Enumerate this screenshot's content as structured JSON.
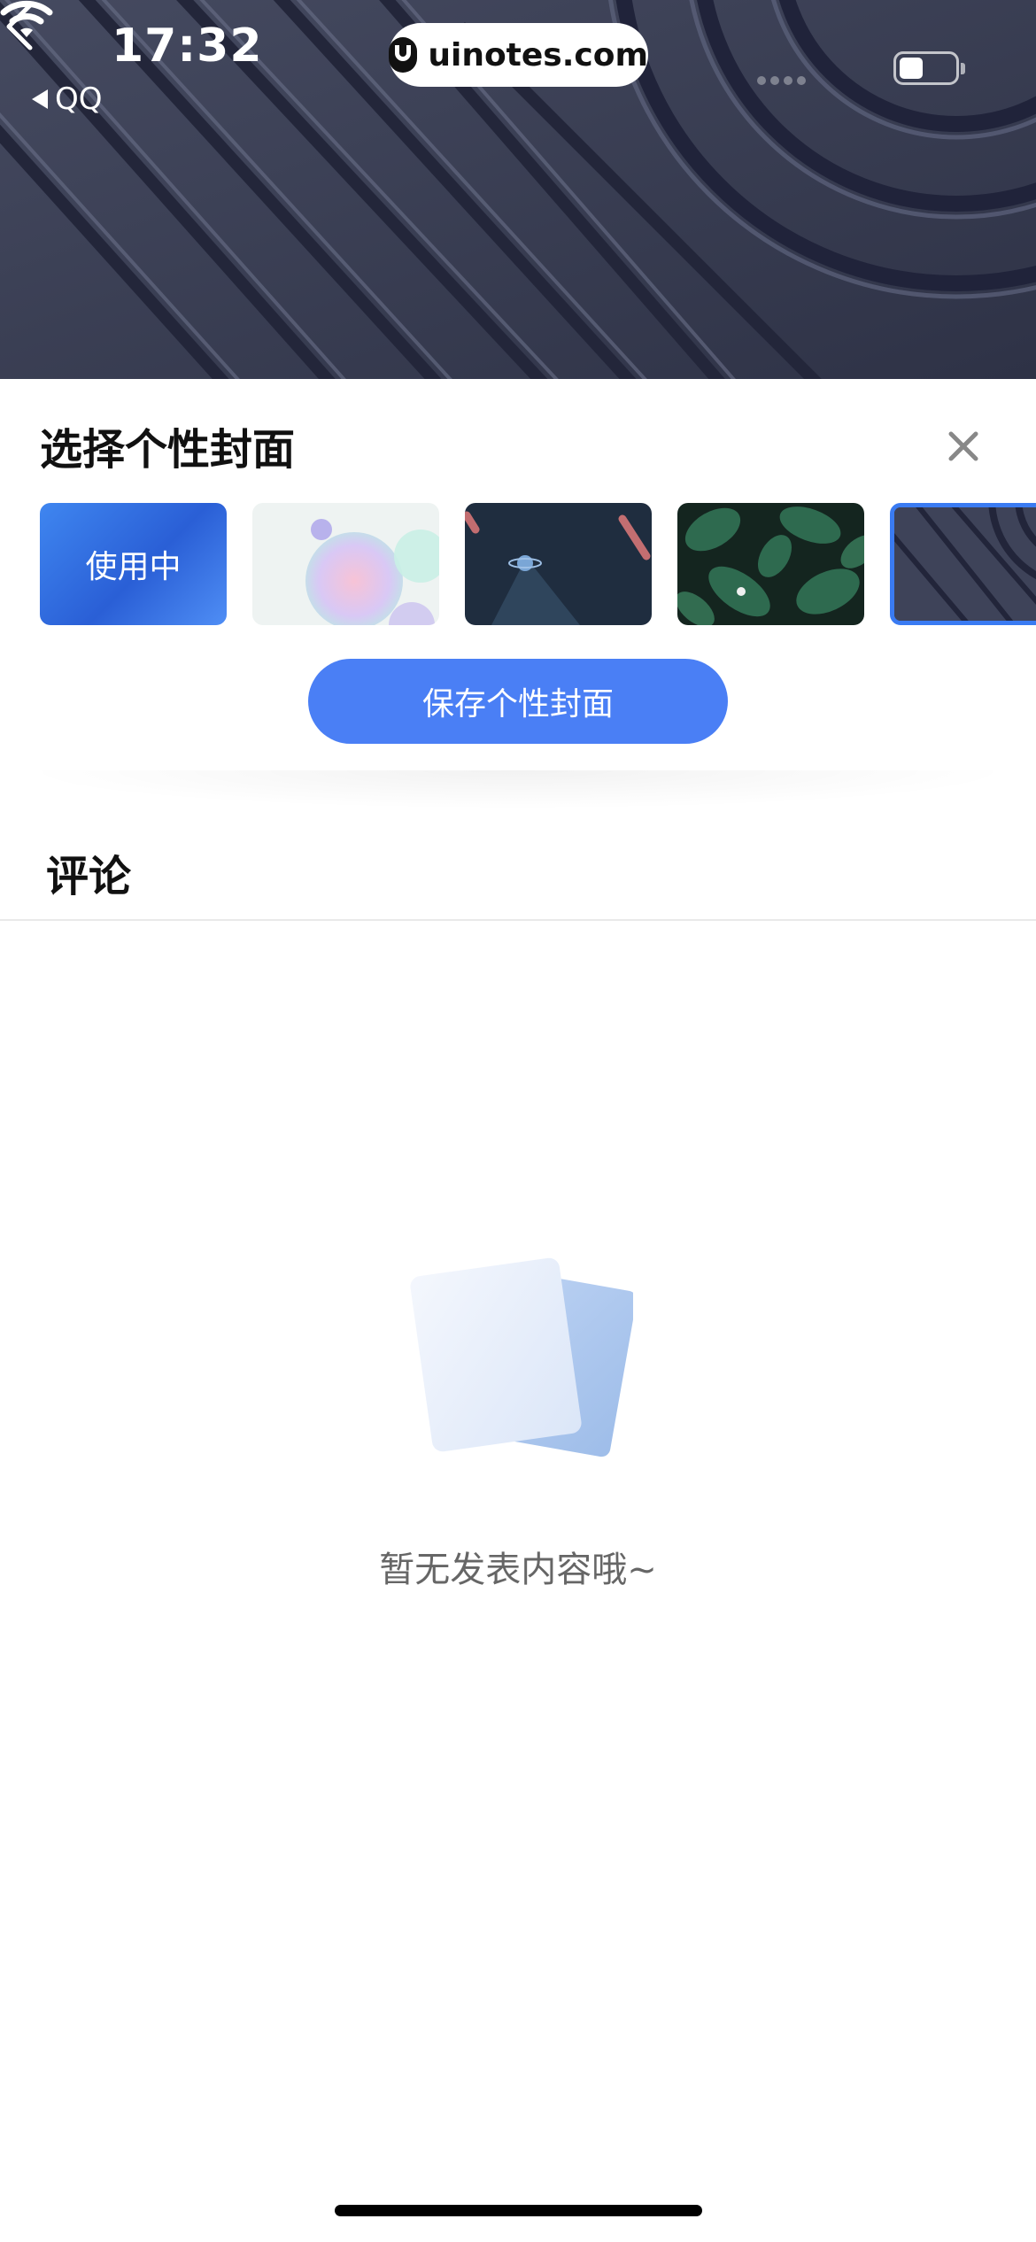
{
  "status_bar": {
    "time": "17:32",
    "back_app_label": "QQ",
    "url": "uinotes.com",
    "battery_level": 0.44
  },
  "header": {
    "back_icon": "chevron-left-icon"
  },
  "cover_picker": {
    "title": "选择个性封面",
    "close_icon": "close-icon",
    "thumbnails": [
      {
        "badge": "使用中",
        "theme": "blue-gradient",
        "state": "in-use"
      },
      {
        "theme": "pastel-bubbles"
      },
      {
        "theme": "space-planet"
      },
      {
        "theme": "green-leaves"
      },
      {
        "theme": "dark-stripes",
        "state": "selected"
      }
    ],
    "save_label": "保存个性封面",
    "accent_color": "#4a7ff5"
  },
  "comments": {
    "title": "评论",
    "empty_text": "暂无发表内容哦~",
    "empty_icon": "empty-documents-icon"
  }
}
